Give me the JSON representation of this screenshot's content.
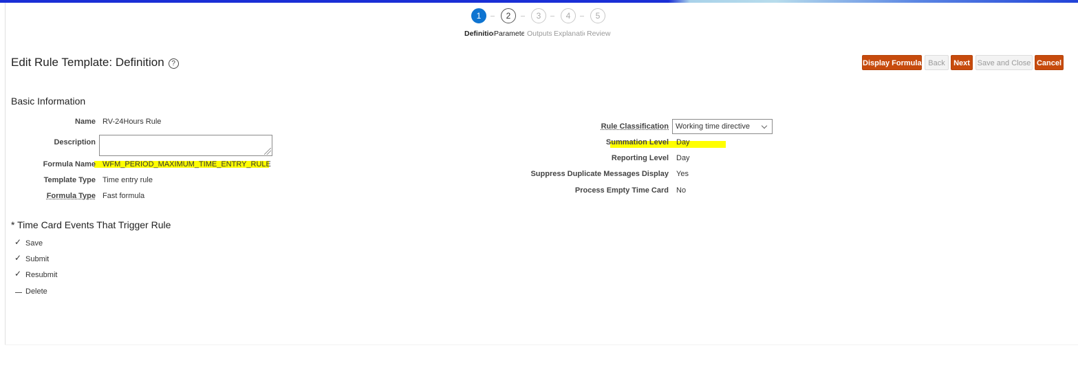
{
  "train": {
    "steps": [
      {
        "num": "1",
        "label": "Definition"
      },
      {
        "num": "2",
        "label": "Parameters"
      },
      {
        "num": "3",
        "label": "Outputs"
      },
      {
        "num": "4",
        "label": "Explanation"
      },
      {
        "num": "5",
        "label": "Review"
      }
    ],
    "current_step": 1
  },
  "header": {
    "title": "Edit Rule Template: Definition",
    "help_icon": "help-circle-icon"
  },
  "toolbar": {
    "display_formula": "Display Formula",
    "back": "Back",
    "next": "Next",
    "save_close": "Save and Close",
    "cancel": "Cancel"
  },
  "basic_info": {
    "section_title": "Basic Information",
    "name_label": "Name",
    "name_value": "RV-24Hours Rule",
    "description_label": "Description",
    "description_value": "",
    "formula_name_label": "Formula Name",
    "formula_name_value": "WFM_PERIOD_MAXIMUM_TIME_ENTRY_RULE",
    "template_type_label": "Template Type",
    "template_type_value": "Time entry rule",
    "formula_type_label": "Formula Type",
    "formula_type_value": "Fast formula"
  },
  "right_panel": {
    "rule_classification_label": "Rule Classification",
    "rule_classification_value": "Working time directive",
    "summation_level_label": "Summation Level",
    "summation_level_value": "Day",
    "reporting_level_label": "Reporting Level",
    "reporting_level_value": "Day",
    "suppress_dup_label": "Suppress Duplicate Messages Display",
    "suppress_dup_value": "Yes",
    "process_empty_label": "Process Empty Time Card",
    "process_empty_value": "No"
  },
  "events": {
    "section_title": "* Time Card Events That Trigger Rule",
    "items": [
      {
        "label": "Save",
        "checked": true
      },
      {
        "label": "Submit",
        "checked": true
      },
      {
        "label": "Resubmit",
        "checked": true
      },
      {
        "label": "Delete",
        "checked": false
      }
    ]
  },
  "colors": {
    "primary_button": "#c74b0d",
    "current_step": "#0e74d1",
    "highlight": "#ffff00",
    "top_bar": "#1a2fd6"
  }
}
